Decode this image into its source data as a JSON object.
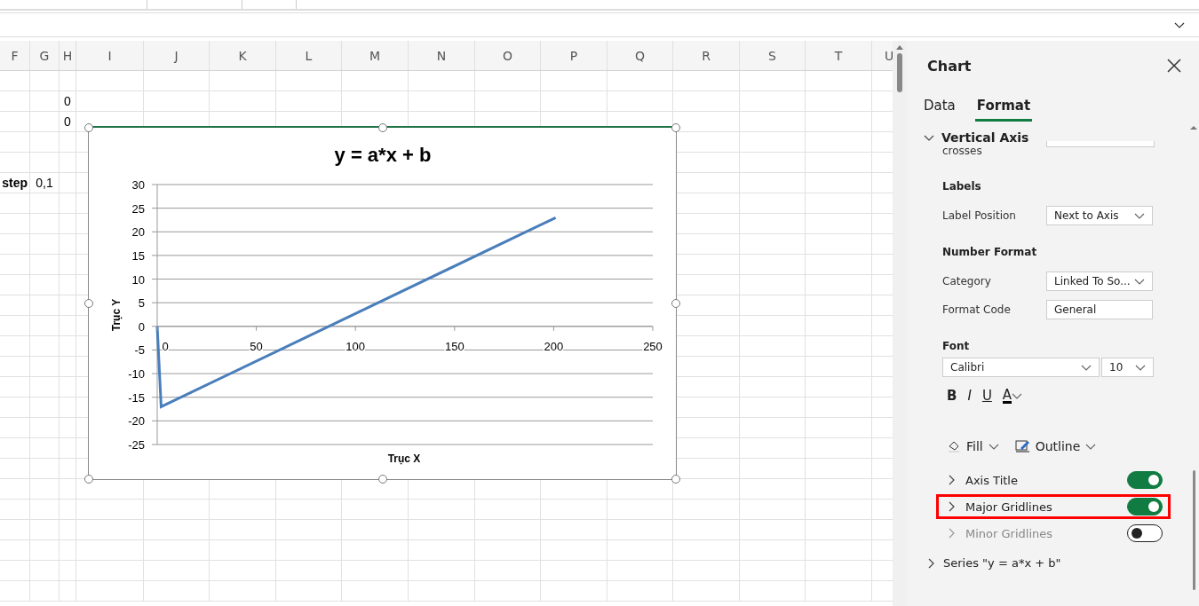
{
  "sheet": {
    "columns": [
      {
        "label": "F"
      },
      {
        "label": "G"
      },
      {
        "label": "H"
      },
      {
        "label": "I"
      },
      {
        "label": "J"
      },
      {
        "label": "K"
      },
      {
        "label": "L"
      },
      {
        "label": "M"
      },
      {
        "label": "N"
      },
      {
        "label": "O"
      },
      {
        "label": "P"
      },
      {
        "label": "Q"
      },
      {
        "label": "R"
      },
      {
        "label": "S"
      },
      {
        "label": "T"
      },
      {
        "label": "U"
      }
    ],
    "rows": [
      {},
      {
        "cells": [
          null,
          null,
          {
            "text": "0",
            "bold": false
          }
        ]
      },
      {
        "cells": [
          null,
          null,
          {
            "text": "0",
            "bold": false
          }
        ]
      },
      {},
      {},
      {
        "cells": [
          {
            "text": "step",
            "bold": true
          },
          {
            "text": "0,1",
            "bold": false
          }
        ]
      }
    ]
  },
  "chart": {
    "selected": true,
    "chart_data": {
      "type": "line",
      "title": "y = a*x + b",
      "xlabel": "Trục X",
      "ylabel": "Trục Y",
      "x": [
        0,
        2,
        201
      ],
      "grid": true,
      "series": [
        {
          "color": "#4a7ebb",
          "values": [
            0,
            -17,
            23
          ]
        }
      ],
      "xlim": [
        0,
        250
      ],
      "ylim": [
        -25,
        30
      ],
      "xticks": [
        0,
        50,
        100,
        150,
        200,
        250
      ],
      "yticks": [
        30,
        25,
        20,
        15,
        10,
        5,
        0,
        -5,
        -10,
        -15,
        -20,
        -25
      ]
    }
  },
  "panel": {
    "title": "Chart",
    "tabs": [
      {
        "label": "Data",
        "selected": false
      },
      {
        "label": "Format",
        "selected": true
      }
    ],
    "section": {
      "title": "Vertical Axis",
      "expanded": true,
      "cut_label": "crosses",
      "groups": [
        {
          "heading": "Labels",
          "fields": [
            {
              "kind": "dropdown",
              "label": "Label Position",
              "value": "Next to Axis"
            }
          ]
        },
        {
          "heading": "Number Format",
          "fields": [
            {
              "kind": "dropdown",
              "label": "Category",
              "value": "Linked To So..."
            },
            {
              "kind": "input",
              "label": "Format Code",
              "value": "General"
            }
          ]
        }
      ],
      "font": {
        "heading": "Font",
        "family": "Calibri",
        "size": "10",
        "styles": [
          {
            "kind": "bold",
            "label": "B"
          },
          {
            "kind": "italic",
            "label": "I"
          },
          {
            "kind": "underline",
            "label": "U"
          },
          {
            "kind": "color",
            "label": "A"
          }
        ]
      },
      "fill_label": "Fill",
      "outline_label": "Outline",
      "toggles": [
        {
          "label": "Axis Title",
          "on": true,
          "disabled": false,
          "highlighted": false
        },
        {
          "label": "Major Gridlines",
          "on": true,
          "disabled": false,
          "highlighted": true
        },
        {
          "label": "Minor Gridlines",
          "on": false,
          "disabled": true,
          "highlighted": false
        }
      ]
    },
    "next_section": {
      "title": "Series \"y = a*x + b\"",
      "expanded": false
    }
  }
}
